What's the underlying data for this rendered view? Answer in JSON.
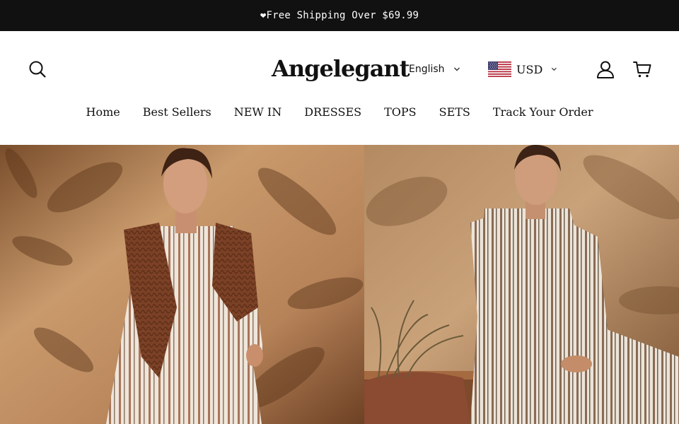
{
  "announcement": {
    "text": "❤Free Shipping Over $69.99"
  },
  "header": {
    "logo": "Angelegant",
    "language": {
      "selected": "English"
    },
    "currency": {
      "selected": "USD"
    },
    "icons": {
      "search": "search-icon",
      "account": "user-icon",
      "cart": "cart-icon",
      "dropdown": "chevron-down-icon",
      "flag": "us-flag-icon"
    }
  },
  "nav": {
    "items": [
      {
        "label": "Home"
      },
      {
        "label": "Best Sellers"
      },
      {
        "label": "NEW IN"
      },
      {
        "label": "DRESSES"
      },
      {
        "label": "TOPS"
      },
      {
        "label": "SETS"
      },
      {
        "label": "Track Your Order"
      }
    ]
  },
  "hero": {
    "panels": [
      {
        "name": "model-striped-shirt-dress-brown-sweater"
      },
      {
        "name": "model-striped-shirt-dress-seated"
      }
    ]
  },
  "colors": {
    "announcement_bg": "#111111",
    "announcement_text": "#ffffff",
    "text": "#111111",
    "hero_wall": "#c89a6e"
  }
}
